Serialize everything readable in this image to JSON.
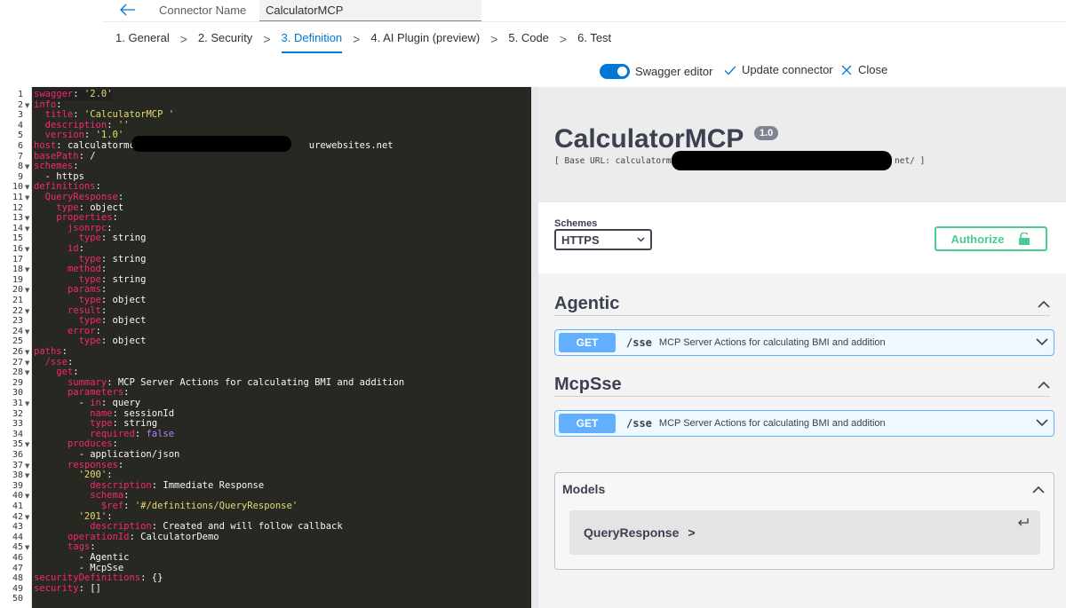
{
  "header": {
    "name_label": "Connector Name",
    "name_value": "CalculatorMCP",
    "steps": [
      {
        "label": "1. General",
        "active": false
      },
      {
        "label": "2. Security",
        "active": false
      },
      {
        "label": "3. Definition",
        "active": true
      },
      {
        "label": "4. AI Plugin (preview)",
        "active": false
      },
      {
        "label": "5. Code",
        "active": false
      },
      {
        "label": "6. Test",
        "active": false
      }
    ],
    "step_separator": ">",
    "swagger_toggle_label": "Swagger editor",
    "swagger_toggle_on": true,
    "update_label": "Update connector",
    "close_label": "Close",
    "accent_color": "#0078d4"
  },
  "editor": {
    "lines": [
      [
        [
          "k",
          "swagger"
        ],
        [
          "v",
          ": "
        ],
        [
          "s",
          "'2.0'"
        ]
      ],
      [
        [
          "k",
          "info"
        ],
        [
          "v",
          ":"
        ]
      ],
      [
        [
          "v",
          "  "
        ],
        [
          "k",
          "title"
        ],
        [
          "v",
          ": "
        ],
        [
          "s",
          "'CalculatorMCP '"
        ]
      ],
      [
        [
          "v",
          "  "
        ],
        [
          "k",
          "description"
        ],
        [
          "v",
          ": "
        ],
        [
          "s",
          "''"
        ]
      ],
      [
        [
          "v",
          "  "
        ],
        [
          "k",
          "version"
        ],
        [
          "v",
          ": "
        ],
        [
          "s",
          "'1.0'"
        ]
      ],
      [
        [
          "k",
          "host"
        ],
        [
          "v",
          ": calculatormcp"
        ],
        [
          "v",
          "                              "
        ],
        [
          "v",
          "urewebsites.net"
        ]
      ],
      [
        [
          "k",
          "basePath"
        ],
        [
          "v",
          ": /"
        ]
      ],
      [
        [
          "k",
          "schemes"
        ],
        [
          "v",
          ":"
        ]
      ],
      [
        [
          "v",
          "  - https"
        ]
      ],
      [
        [
          "k",
          "definitions"
        ],
        [
          "v",
          ":"
        ]
      ],
      [
        [
          "v",
          "  "
        ],
        [
          "k",
          "QueryResponse"
        ],
        [
          "v",
          ":"
        ]
      ],
      [
        [
          "v",
          "    "
        ],
        [
          "k",
          "type"
        ],
        [
          "v",
          ": object"
        ]
      ],
      [
        [
          "v",
          "    "
        ],
        [
          "k",
          "properties"
        ],
        [
          "v",
          ":"
        ]
      ],
      [
        [
          "v",
          "      "
        ],
        [
          "k",
          "jsonrpc"
        ],
        [
          "v",
          ":"
        ]
      ],
      [
        [
          "v",
          "        "
        ],
        [
          "k",
          "type"
        ],
        [
          "v",
          ": string"
        ]
      ],
      [
        [
          "v",
          "      "
        ],
        [
          "k",
          "id"
        ],
        [
          "v",
          ":"
        ]
      ],
      [
        [
          "v",
          "        "
        ],
        [
          "k",
          "type"
        ],
        [
          "v",
          ": string"
        ]
      ],
      [
        [
          "v",
          "      "
        ],
        [
          "k",
          "method"
        ],
        [
          "v",
          ":"
        ]
      ],
      [
        [
          "v",
          "        "
        ],
        [
          "k",
          "type"
        ],
        [
          "v",
          ": string"
        ]
      ],
      [
        [
          "v",
          "      "
        ],
        [
          "k",
          "params"
        ],
        [
          "v",
          ":"
        ]
      ],
      [
        [
          "v",
          "        "
        ],
        [
          "k",
          "type"
        ],
        [
          "v",
          ": object"
        ]
      ],
      [
        [
          "v",
          "      "
        ],
        [
          "k",
          "result"
        ],
        [
          "v",
          ":"
        ]
      ],
      [
        [
          "v",
          "        "
        ],
        [
          "k",
          "type"
        ],
        [
          "v",
          ": object"
        ]
      ],
      [
        [
          "v",
          "      "
        ],
        [
          "k",
          "error"
        ],
        [
          "v",
          ":"
        ]
      ],
      [
        [
          "v",
          "        "
        ],
        [
          "k",
          "type"
        ],
        [
          "v",
          ": object"
        ]
      ],
      [
        [
          "k",
          "paths"
        ],
        [
          "v",
          ":"
        ]
      ],
      [
        [
          "v",
          "  "
        ],
        [
          "k",
          "/sse"
        ],
        [
          "v",
          ":"
        ]
      ],
      [
        [
          "v",
          "    "
        ],
        [
          "k",
          "get"
        ],
        [
          "v",
          ":"
        ]
      ],
      [
        [
          "v",
          "      "
        ],
        [
          "k",
          "summary"
        ],
        [
          "v",
          ": MCP Server Actions for calculating BMI and addition"
        ]
      ],
      [
        [
          "v",
          "      "
        ],
        [
          "k",
          "parameters"
        ],
        [
          "v",
          ":"
        ]
      ],
      [
        [
          "v",
          "        - "
        ],
        [
          "k",
          "in"
        ],
        [
          "v",
          ": query"
        ]
      ],
      [
        [
          "v",
          "          "
        ],
        [
          "k",
          "name"
        ],
        [
          "v",
          ": sessionId"
        ]
      ],
      [
        [
          "v",
          "          "
        ],
        [
          "k",
          "type"
        ],
        [
          "v",
          ": string"
        ]
      ],
      [
        [
          "v",
          "          "
        ],
        [
          "k",
          "required"
        ],
        [
          "v",
          ": "
        ],
        [
          "b",
          "false"
        ]
      ],
      [
        [
          "v",
          "      "
        ],
        [
          "k",
          "produces"
        ],
        [
          "v",
          ":"
        ]
      ],
      [
        [
          "v",
          "        - application/json"
        ]
      ],
      [
        [
          "v",
          "      "
        ],
        [
          "k",
          "responses"
        ],
        [
          "v",
          ":"
        ]
      ],
      [
        [
          "v",
          "        "
        ],
        [
          "s",
          "'200'"
        ],
        [
          "v",
          ":"
        ]
      ],
      [
        [
          "v",
          "          "
        ],
        [
          "k",
          "description"
        ],
        [
          "v",
          ": Immediate Response"
        ]
      ],
      [
        [
          "v",
          "          "
        ],
        [
          "k",
          "schema"
        ],
        [
          "v",
          ":"
        ]
      ],
      [
        [
          "v",
          "            "
        ],
        [
          "k",
          "$ref"
        ],
        [
          "v",
          ": "
        ],
        [
          "s",
          "'#/definitions/QueryResponse'"
        ]
      ],
      [
        [
          "v",
          "        "
        ],
        [
          "s",
          "'201'"
        ],
        [
          "v",
          ":"
        ]
      ],
      [
        [
          "v",
          "          "
        ],
        [
          "k",
          "description"
        ],
        [
          "v",
          ": Created and will follow callback"
        ]
      ],
      [
        [
          "v",
          "      "
        ],
        [
          "k",
          "operationId"
        ],
        [
          "v",
          ": CalculatorDemo"
        ]
      ],
      [
        [
          "v",
          "      "
        ],
        [
          "k",
          "tags"
        ],
        [
          "v",
          ":"
        ]
      ],
      [
        [
          "v",
          "        - Agentic"
        ]
      ],
      [
        [
          "v",
          "        - McpSse"
        ]
      ],
      [
        [
          "k",
          "securityDefinitions"
        ],
        [
          "v",
          ": {}"
        ]
      ],
      [
        [
          "k",
          "security"
        ],
        [
          "v",
          ": []"
        ]
      ],
      []
    ],
    "foldable_lines": [
      2,
      8,
      10,
      11,
      13,
      14,
      16,
      18,
      20,
      22,
      24,
      26,
      27,
      28,
      31,
      35,
      37,
      38,
      40,
      42,
      45
    ],
    "colors": {
      "background": "#272822",
      "key": "#f92672",
      "value": "#f8f8f2",
      "string": "#e6db74",
      "boolean": "#ae81ff"
    }
  },
  "swagger": {
    "title": "CalculatorMCP",
    "version": "1.0",
    "base_url_prefix": "[ Base URL: calculatormcp",
    "base_url_suffix": "net/ ]",
    "schemes_label": "Schemes",
    "schemes_value": "HTTPS",
    "authorize_label": "Authorize",
    "tags": [
      {
        "name": "Agentic",
        "op": {
          "method": "GET",
          "path": "/sse",
          "summary": "MCP Server Actions for calculating BMI and addition"
        }
      },
      {
        "name": "McpSse",
        "op": {
          "method": "GET",
          "path": "/sse",
          "summary": "MCP Server Actions for calculating BMI and addition"
        }
      }
    ],
    "models_label": "Models",
    "model_name": "QueryResponse",
    "model_arrow": ">",
    "colors": {
      "get": "#61affe",
      "authorize": "#49cc90",
      "text": "#3b4151"
    }
  }
}
